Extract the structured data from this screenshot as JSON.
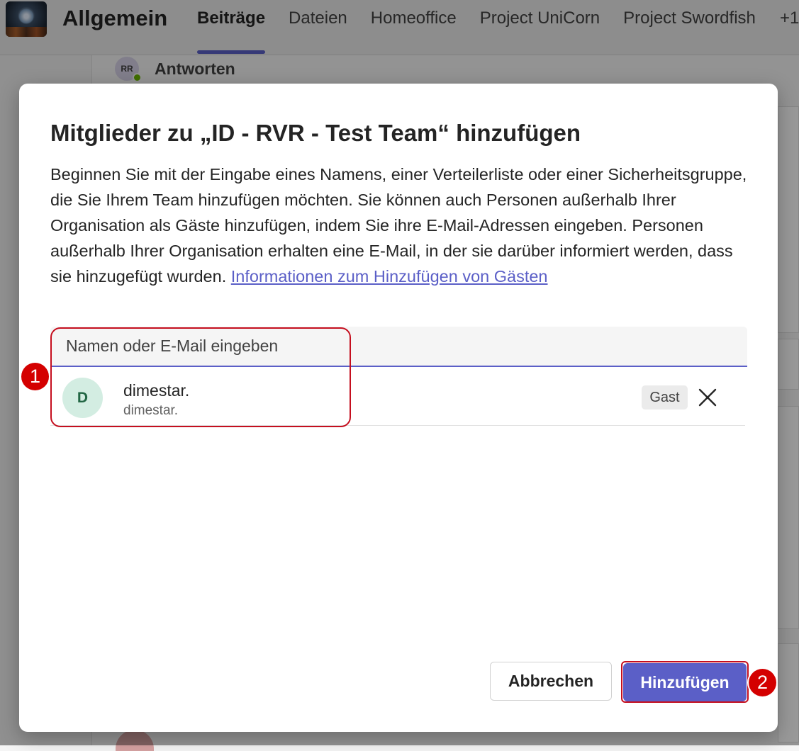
{
  "app": {
    "team_name": "Allgemein",
    "tabs": [
      {
        "label": "Beiträge",
        "active": true
      },
      {
        "label": "Dateien",
        "active": false
      },
      {
        "label": "Homeoffice",
        "active": false
      },
      {
        "label": "Project UniCorn",
        "active": false
      },
      {
        "label": "Project Swordfish",
        "active": false
      }
    ],
    "tabs_more": "+1",
    "reply": {
      "avatar_initials": "RR",
      "label": "Antworten"
    }
  },
  "dialog": {
    "title": "Mitglieder zu „ID - RVR - Test Team“ hinzufügen",
    "description": "Beginnen Sie mit der Eingabe eines Namens, einer Verteilerliste oder einer Sicherheitsgruppe, die Sie Ihrem Team hinzufügen möchten. Sie können auch Personen außerhalb Ihrer Organisation als Gäste hinzufügen, indem Sie ihre E-Mail-Adressen eingeben. Personen außerhalb Ihrer Organisation erhalten eine E-Mail, in der sie darüber informiert werden, dass sie hinzugefügt wurden.",
    "link_text": "Informationen zum Hinzufügen von Gästen",
    "search": {
      "placeholder": "Namen oder E-Mail eingeben",
      "value": ""
    },
    "members": [
      {
        "initial": "D",
        "name": "dimestar.",
        "subtitle": "dimestar.",
        "badge": "Gast",
        "remove_icon": "close-icon"
      }
    ],
    "buttons": {
      "cancel": "Abbrechen",
      "add": "Hinzufügen"
    }
  },
  "annotations": [
    {
      "number": "1"
    },
    {
      "number": "2"
    }
  ],
  "colors": {
    "accent": "#5b5fc7",
    "annotation_red": "#c50f1f",
    "online_green": "#6bb700",
    "avatar_green_bg": "#d3ede2"
  }
}
